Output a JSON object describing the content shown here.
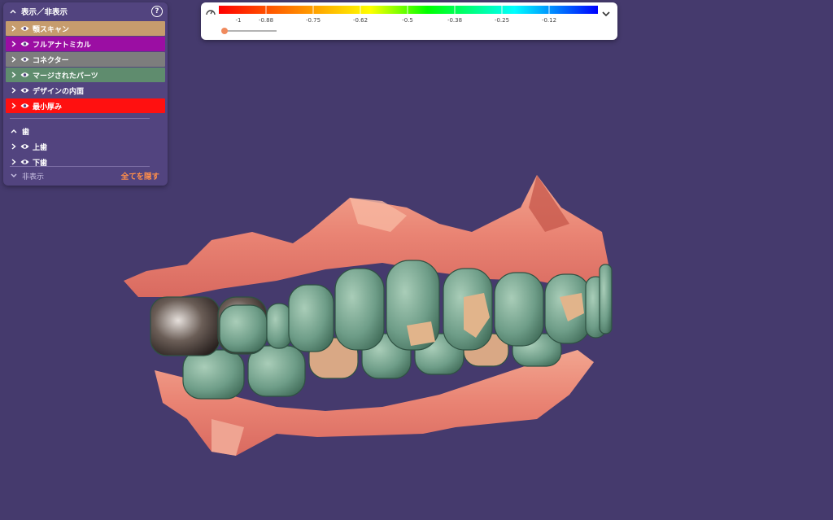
{
  "panel": {
    "title": "表示／非表示",
    "help_symbol": "?",
    "items": [
      {
        "label": "顎スキャン",
        "color": "#c69c6d"
      },
      {
        "label": "フルアナトミカル",
        "color": "#9b0ea3"
      },
      {
        "label": "コネクター",
        "color": "#7d7d7d"
      },
      {
        "label": "マージされたパーツ",
        "color": "#5f8c6e"
      },
      {
        "label": "デザインの内面",
        "color": ""
      },
      {
        "label": "最小厚み",
        "color": "#ff1010"
      }
    ],
    "teeth_group": {
      "label": "歯",
      "items": [
        {
          "label": "上歯"
        },
        {
          "label": "下歯"
        }
      ]
    },
    "footer": {
      "hidden_label": "非表示",
      "hide_all_label": "全てを隠す"
    }
  },
  "colorbar": {
    "ticks": [
      "-1",
      "-0.88",
      "-0.75",
      "-0.62",
      "-0.5",
      "-0.38",
      "-0.25",
      "-0.12"
    ],
    "gradient_colors": [
      "#ff0000",
      "#ff8000",
      "#ffff00",
      "#00ff00",
      "#00ffff",
      "#0000ff"
    ],
    "slider_color": "#f08a5d"
  }
}
